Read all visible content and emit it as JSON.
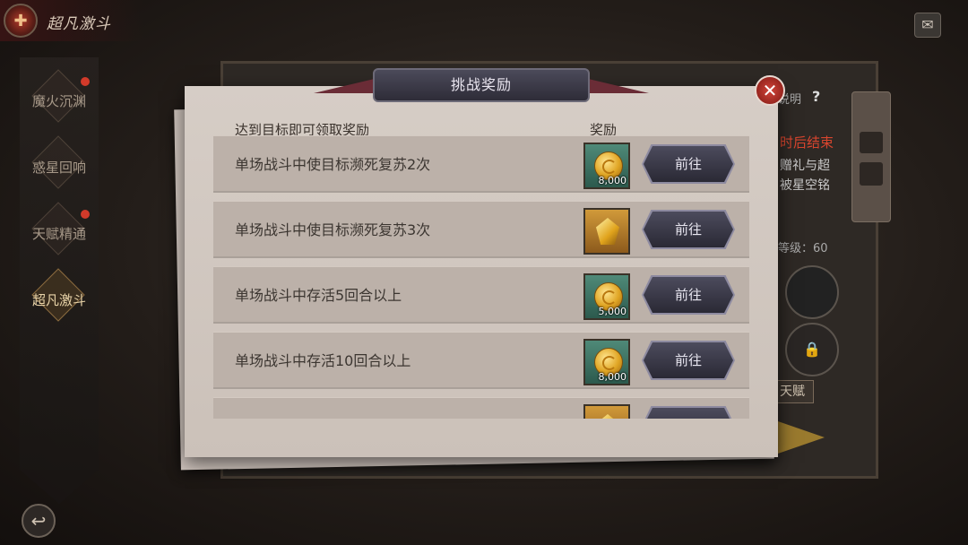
{
  "header": {
    "title": "超凡激斗"
  },
  "sidebar": {
    "items": [
      {
        "label": "魔火沉渊",
        "badge": true,
        "active": false
      },
      {
        "label": "惑星回响",
        "badge": false,
        "active": false
      },
      {
        "label": "天赋精通",
        "badge": true,
        "active": false
      },
      {
        "label": "超凡激斗",
        "badge": false,
        "active": true
      }
    ]
  },
  "background_panel": {
    "help_label": "说明",
    "help_icon": "?",
    "timer_text": "时后结束",
    "desc_line1": "赠礼与超",
    "desc_line2": "被星空铭",
    "level_text": "等级：60",
    "talent_tab": "天赋"
  },
  "modal": {
    "title": "挑战奖励",
    "close_icon": "✕",
    "column_task": "达到目标即可领取奖励",
    "column_reward": "奖励",
    "rows": [
      {
        "task": "单场战斗中使目标濒死复苏2次",
        "reward_icon": "gold-coin-icon",
        "reward_rarity": "green",
        "quantity": "8,000",
        "button": "前往"
      },
      {
        "task": "单场战斗中使目标濒死复苏3次",
        "reward_icon": "gold-gem-icon",
        "reward_rarity": "orange",
        "quantity": "",
        "button": "前往"
      },
      {
        "task": "单场战斗中存活5回合以上",
        "reward_icon": "gold-coin-icon",
        "reward_rarity": "green",
        "quantity": "5,000",
        "button": "前往"
      },
      {
        "task": "单场战斗中存活10回合以上",
        "reward_icon": "gold-coin-icon",
        "reward_rarity": "green",
        "quantity": "8,000",
        "button": "前往"
      },
      {
        "task": "",
        "reward_icon": "gold-gem-icon",
        "reward_rarity": "orange",
        "quantity": "",
        "button": ""
      }
    ]
  },
  "colors": {
    "accent_red": "#d23a2a",
    "paper": "#d6cdc6",
    "button_dark": "#2e2c38",
    "reward_green": "#2c5a4d",
    "reward_orange": "#d19a3a"
  }
}
